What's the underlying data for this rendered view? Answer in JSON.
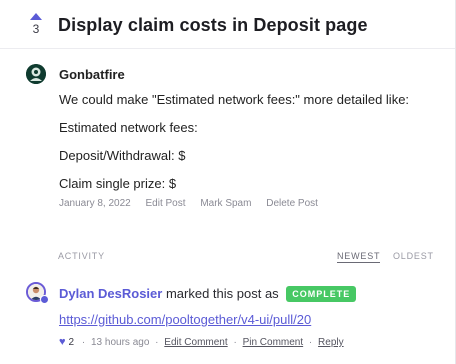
{
  "post": {
    "vote_count": "3",
    "title": "Display claim costs in Deposit page",
    "author": "Gonbatfire",
    "body": [
      "We could make \"Estimated network fees:\" more detailed like:",
      "Estimated network fees:",
      "Deposit/Withdrawal: $",
      "Claim single prize: $"
    ],
    "date": "January 8, 2022",
    "actions": [
      "Edit Post",
      "Mark Spam",
      "Delete Post"
    ]
  },
  "activity": {
    "label": "Activity",
    "sort_newest": "Newest",
    "sort_oldest": "Oldest",
    "entry": {
      "author": "Dylan DesRosier",
      "text": "marked this post as",
      "status": "COMPLETE",
      "link": "https://github.com/pooltogether/v4-ui/pull/20",
      "likes": "2",
      "time": "13 hours ago",
      "actions": [
        "Edit Comment",
        "Pin Comment",
        "Reply"
      ]
    }
  },
  "colors": {
    "accent": "#5b5bd6",
    "status_complete": "#47c864"
  },
  "icons": {
    "upvote": "triangle-up-icon",
    "heart": "heart-icon"
  }
}
